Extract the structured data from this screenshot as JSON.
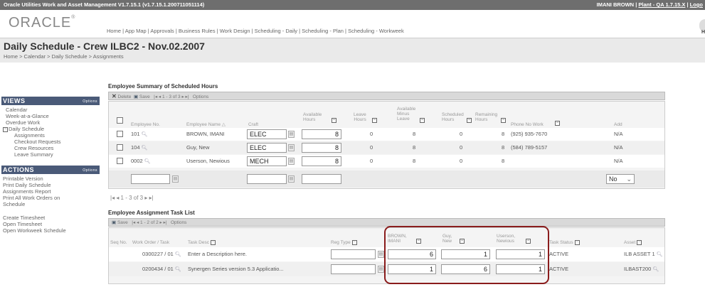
{
  "app": {
    "title": "Oracle Utilities Work and Asset Management V1.7.15.1 (v1.7.15.1.200711051114)",
    "user": "IMANI BROWN",
    "separator": " | ",
    "plant_link": "Plant - QA 1.7.15.X",
    "separator2": " | ",
    "logout": "Logo"
  },
  "logo": {
    "text": "ORACLE",
    "mark": "®"
  },
  "topnav": "Home | App Map | Approvals | Business Rules | Work Design | Scheduling - Daily | Scheduling - Plan | Scheduling - Workweek",
  "help_label": "H",
  "page": {
    "title": "Daily Schedule - Crew ILBC2 - Nov.02.2007",
    "breadcrumb": "Home > Calendar > Daily Schedule > Assignments"
  },
  "sidebar": {
    "views_title": "VIEWS",
    "views_options": "Options",
    "views": [
      "Calendar",
      "Week-at-a-Glance",
      "Overdue Work"
    ],
    "daily_schedule": "Daily Schedule",
    "sub": [
      "Assignments",
      "Checkout Requests",
      "Crew Resources",
      "Leave Summary"
    ],
    "actions_title": "ACTIONS",
    "actions_options": "Options",
    "actions": [
      "Printable Version",
      "Print Daily Schedule",
      "Assignments Report",
      "Print All Work Orders on",
      "Schedule"
    ],
    "actions2": [
      "Create Timesheet",
      "Open Timesheet",
      "Open Workweek Schedule"
    ]
  },
  "summary": {
    "title": "Employee Summary of Scheduled Hours",
    "toolbar": {
      "delete": "Delete",
      "save": "Save",
      "pager": "|◂ ◂ 1 - 3 of 3 ▸ ▸|",
      "options": "Options"
    },
    "headers": {
      "emp_no": "Employee No.",
      "emp_name": "Employee Name △",
      "craft": "Craft",
      "avail": "Available\nHours",
      "leave": "Leave\nHours",
      "avail_minus": "Available\nMinus\nLeave",
      "scheduled": "Scheduled\nHours",
      "remaining": "Remaining\nHours",
      "phone": "Phone No Work",
      "add": "Add"
    },
    "rows": [
      {
        "emp_no": "101",
        "name": "BROWN, IMANI",
        "craft": "ELEC",
        "avail": "8",
        "leave": "0",
        "minus": "8",
        "sched": "0",
        "remain": "8",
        "phone": "(925) 935-7670",
        "add": "N/A"
      },
      {
        "emp_no": "104",
        "name": "Guy, New",
        "craft": "ELEC",
        "avail": "8",
        "leave": "0",
        "minus": "8",
        "sched": "0",
        "remain": "8",
        "phone": "(584) 789-5157",
        "add": "N/A"
      },
      {
        "emp_no": "0002",
        "name": "Userson, Newious",
        "craft": "MECH",
        "avail": "8",
        "leave": "0",
        "minus": "8",
        "sched": "0",
        "remain": "8",
        "phone": "",
        "add": "N/A"
      }
    ],
    "add_select": "No",
    "pager_bottom": "|◂ ◂ 1 - 3 of 3 ▸ ▸|"
  },
  "tasks": {
    "title": "Employee Assignment Task List",
    "toolbar": {
      "save": "Save",
      "pager": "|◂ ◂ 1 - 2 of 2 ▸ ▸|",
      "options": "Options"
    },
    "headers": {
      "seq": "Seq No.",
      "wo": "Work Order / Task",
      "desc": "Task Desc",
      "reg": "Reg Type",
      "brown": "BROWN,\nIMANI",
      "guy": "Guy,\nNew",
      "userson": "Userson,\nNewious",
      "status": "Task Status",
      "asset": "Asset"
    },
    "rows": [
      {
        "wo": "0300227 / 01",
        "desc": "Enter a Description here.",
        "brown": "6",
        "guy": "1",
        "userson": "1",
        "status": "ACTIVE",
        "asset": "ILB ASSET 1"
      },
      {
        "wo": "0200434 / 01",
        "desc": "Synergen Series version 5.3 Applicatio...",
        "brown": "1",
        "guy": "6",
        "userson": "1",
        "status": "ACTIVE",
        "asset": "ILBAST200"
      }
    ]
  }
}
